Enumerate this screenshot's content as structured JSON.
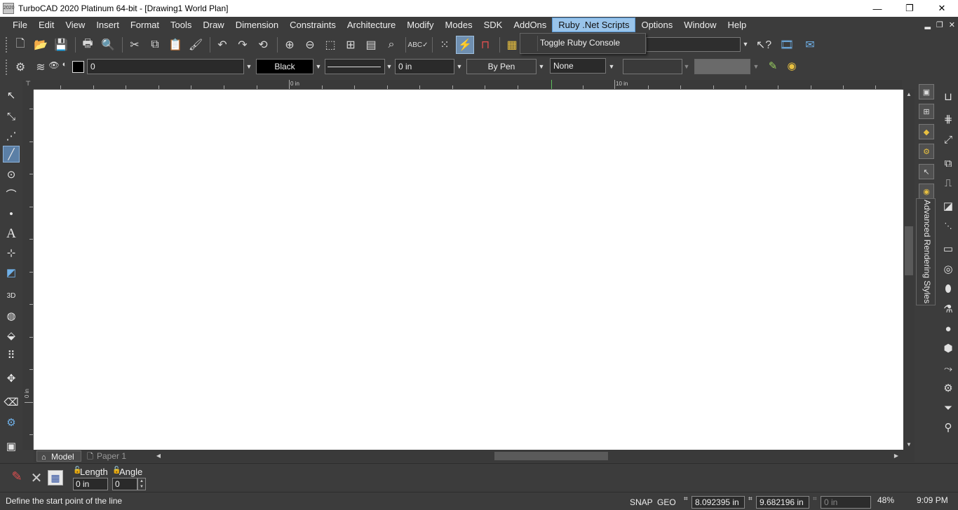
{
  "window": {
    "title": "TurboCAD 2020 Platinum 64-bit - [Drawing1 World Plan]",
    "app_icon_text": "2020",
    "minimize": "—",
    "maximize": "❐",
    "close": "✕"
  },
  "menu": {
    "items": [
      "File",
      "Edit",
      "View",
      "Insert",
      "Format",
      "Tools",
      "Draw",
      "Dimension",
      "Constraints",
      "Architecture",
      "Modify",
      "Modes",
      "SDK",
      "AddOns",
      "Ruby .Net Scripts",
      "Options",
      "Window",
      "Help"
    ],
    "active": "Ruby .Net Scripts",
    "mdi": [
      "▂",
      "❐",
      "✕"
    ]
  },
  "dropdown": {
    "items": [
      "Toggle Ruby Console"
    ]
  },
  "properties": {
    "layer": "0",
    "color": "Black",
    "thickness": "0 in",
    "pen": "By Pen",
    "fill": "None"
  },
  "ruler": {
    "labels": [
      "0 in",
      "10 in"
    ],
    "left_label": "0 in"
  },
  "tabs": {
    "model": "Model",
    "paper": "Paper 1"
  },
  "right_panel": {
    "vertical_label": "Advanced Rendering Styles"
  },
  "input_bar": {
    "length_label": "Length",
    "angle_label": "Angle",
    "length_value": "0 in",
    "angle_value": "0"
  },
  "status": {
    "prompt": "Define the start point of the line",
    "snap": "SNAP",
    "geo": "GEO",
    "x": "8.092395 in",
    "y": "9.682196 in",
    "z": "0 in",
    "zoom": "48%",
    "time": "9:09 PM"
  }
}
